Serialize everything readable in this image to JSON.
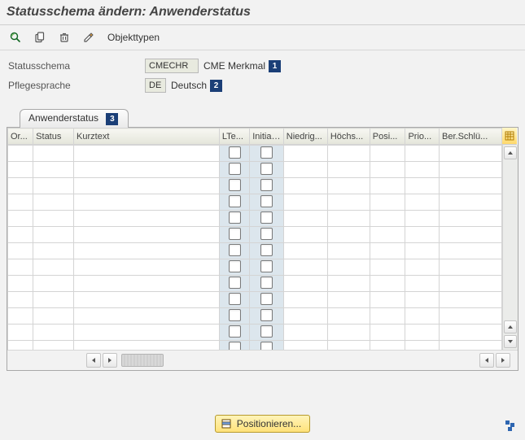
{
  "title": "Statusschema ändern: Anwenderstatus",
  "toolbar": {
    "objekttypen": "Objekttypen"
  },
  "form": {
    "statusschema_label": "Statusschema",
    "statusschema_value": "CMECHR",
    "statusschema_desc": "CME Merkmal",
    "pflegesprache_label": "Pflegesprache",
    "pflegesprache_value": "DE",
    "pflegesprache_desc": "Deutsch"
  },
  "markers": {
    "m1": "1",
    "m2": "2",
    "m3": "3"
  },
  "tab": {
    "anwenderstatus": "Anwenderstatus"
  },
  "columns": {
    "or": "Or...",
    "status": "Status",
    "kurztext": "Kurztext",
    "lte": "LTe...",
    "initial": "Initial...",
    "niedrig": "Niedrig...",
    "hoechst": "Höchs...",
    "posi": "Posi...",
    "prio": "Prio...",
    "ber": "Ber.Schlü..."
  },
  "button": {
    "positionieren": "Positionieren..."
  }
}
